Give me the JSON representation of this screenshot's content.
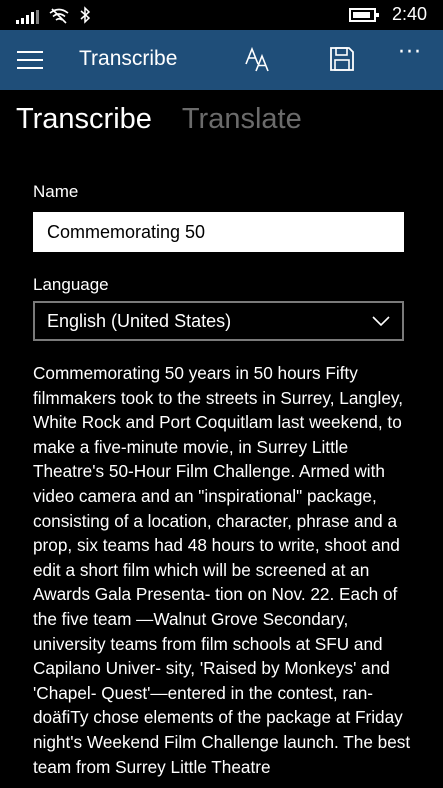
{
  "status_bar": {
    "time": "2:40",
    "icons": [
      "signal-icon",
      "wifi-icon",
      "bluetooth-icon",
      "battery-icon"
    ],
    "battery_level": 0.8
  },
  "app_bar": {
    "title": "Transcribe",
    "icons": [
      "hamburger-menu-icon",
      "font-size-icon",
      "save-icon",
      "more-icon"
    ],
    "background_color": "#1f4e79"
  },
  "pivot": {
    "tabs": [
      {
        "label": "Transcribe",
        "active": true
      },
      {
        "label": "Translate",
        "active": false
      }
    ]
  },
  "form": {
    "name_label": "Name",
    "name_value": "Commemorating 50",
    "language_label": "Language",
    "language_value": "English (United States)"
  },
  "transcript": {
    "text": "Commemorating 50 years in 50 hours Fifty filmmakers took to the streets in Surrey, Langley, White Rock and Port Coquitlam last weekend, to make a five-minute movie, in Surrey Little Theatre's 50-Hour Film Challenge. Armed with video camera and an \"inspirational\" package, consisting of a location, character, phrase and a prop, six teams had 48 hours to write, shoot and edit a short film which will be screened at an Awards Gala Presenta- tion on Nov. 22. Each of the five team —Walnut Grove Secondary, university teams from film schools at SFU and Capilano Univer- sity, 'Raised by Monkeys' and 'Chapel- Quest'—entered in the contest, ran- doäfiTy chose elements of the package at Friday night's Weekend Film Challenge launch. The best team from Surrey Little Theatre"
  }
}
